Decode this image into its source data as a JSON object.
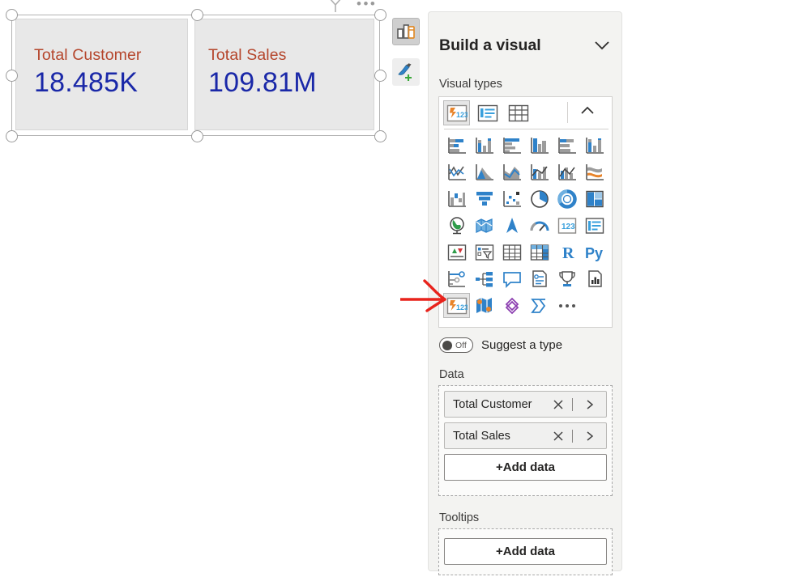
{
  "canvas": {
    "visual": {
      "toolbar": {
        "filter_icon": "funnel-icon",
        "more_options": "•••",
        "buttons": [
          {
            "name": "visualizations-icon",
            "state": "active"
          },
          {
            "name": "format-paintbrush-add-icon",
            "state": "default"
          }
        ]
      },
      "cards": [
        {
          "title": "Total Customer",
          "value": "18.485K"
        },
        {
          "title": "Total Sales",
          "value": "109.81M"
        }
      ],
      "title_color": "#b5462c",
      "value_color": "#1a28a8",
      "card_bg": "#e8e8e8"
    },
    "annotation": {
      "type": "red-arrow",
      "color": "#e8231c",
      "points_to": "card-visual-type"
    }
  },
  "pane": {
    "title": "Build a visual",
    "collapse_icon": "chevron-down-icon",
    "visual_types": {
      "label": "Visual types",
      "collapse_icon": "chevron-up-icon",
      "pinned": [
        "card-icon",
        "multi-row-card-icon",
        "table-icon"
      ],
      "rows": [
        [
          "stacked-bar-chart-icon",
          "stacked-column-chart-icon",
          "clustered-bar-chart-icon",
          "clustered-column-chart-icon",
          "100-stacked-bar-chart-icon",
          "100-stacked-column-chart-icon"
        ],
        [
          "line-chart-icon",
          "area-chart-icon",
          "stacked-area-chart-icon",
          "line-stacked-column-chart-icon",
          "line-clustered-column-chart-icon",
          "ribbon-chart-icon"
        ],
        [
          "waterfall-chart-icon",
          "funnel-chart-icon",
          "scatter-chart-icon",
          "pie-chart-icon",
          "donut-chart-icon",
          "treemap-icon"
        ],
        [
          "map-icon",
          "filled-map-icon",
          "azure-map-icon",
          "gauge-icon",
          "card-icon",
          "multi-row-card-icon"
        ],
        [
          "kpi-icon",
          "slicer-icon",
          "table-icon",
          "matrix-icon",
          "r-script-visual-icon",
          "python-visual-icon"
        ],
        [
          "key-influencers-icon",
          "decomposition-tree-icon",
          "qna-icon",
          "smart-narrative-icon",
          "metrics-icon",
          "paginated-report-icon"
        ],
        [
          "card-icon-selected",
          "arcgis-map-icon",
          "power-apps-icon",
          "power-automate-icon",
          "more-visuals-icon"
        ]
      ],
      "selected": "card-icon"
    },
    "suggest": {
      "toggle_state": "Off",
      "label": "Suggest a type"
    },
    "data": {
      "label": "Data",
      "fields": [
        {
          "name": "Total Customer",
          "remove_icon": "close-icon",
          "expand_icon": "chevron-right-icon"
        },
        {
          "name": "Total Sales",
          "remove_icon": "close-icon",
          "expand_icon": "chevron-right-icon"
        }
      ],
      "add_label": "+Add data"
    },
    "tooltips": {
      "label": "Tooltips",
      "add_label": "+Add data"
    }
  }
}
